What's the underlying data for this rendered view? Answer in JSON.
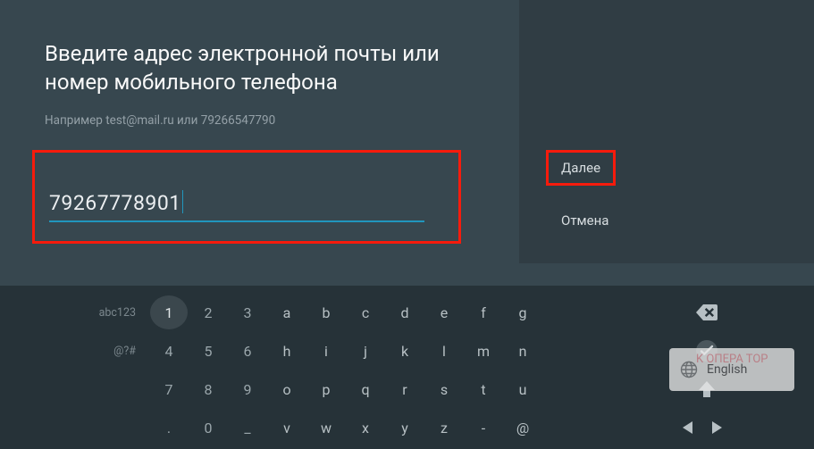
{
  "main": {
    "title": "Введите адрес электронной почты или номер мобильного телефона",
    "hint": "Например test@mail.ru или 79266547790",
    "input_value": "79267778901"
  },
  "actions": {
    "next": "Далее",
    "cancel": "Отмена"
  },
  "keyboard": {
    "row1_label": "abc123",
    "row2_label": "@?#",
    "rows": [
      {
        "nums": [
          "1",
          "2",
          "3"
        ],
        "letters": [
          "a",
          "b",
          "c",
          "d",
          "e",
          "f",
          "g"
        ]
      },
      {
        "nums": [
          "4",
          "5",
          "6"
        ],
        "letters": [
          "h",
          "i",
          "j",
          "k",
          "l",
          "m",
          "n"
        ]
      },
      {
        "nums": [
          "7",
          "8",
          "9"
        ],
        "letters": [
          "o",
          "p",
          "q",
          "r",
          "s",
          "t",
          "u"
        ]
      },
      {
        "nums": [
          ".",
          "0",
          "_"
        ],
        "letters": [
          "v",
          "w",
          "x",
          "y",
          "z",
          "-",
          "@"
        ]
      }
    ]
  },
  "lang": {
    "label": "English",
    "watermark": "K\nОПЕРА\nТОР"
  }
}
